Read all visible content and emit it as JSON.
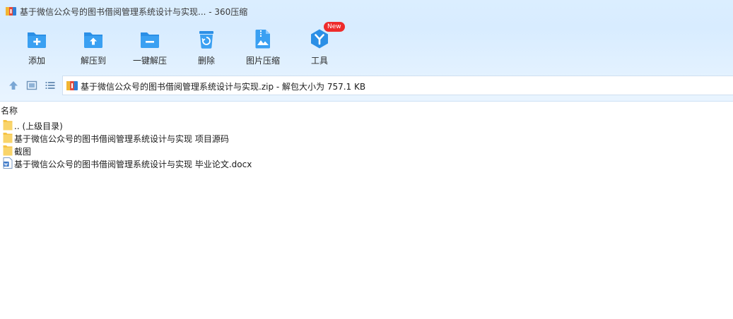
{
  "window": {
    "title": "基于微信公众号的图书借阅管理系统设计与实现... - 360压缩"
  },
  "toolbar": {
    "items": [
      {
        "label": "添加",
        "icon": "add-folder-icon"
      },
      {
        "label": "解压到",
        "icon": "extract-to-icon"
      },
      {
        "label": "一键解压",
        "icon": "one-click-extract-icon"
      },
      {
        "label": "删除",
        "icon": "trash-icon"
      },
      {
        "label": "图片压缩",
        "icon": "image-compress-icon"
      },
      {
        "label": "工具",
        "icon": "tools-icon",
        "badge": "New"
      }
    ]
  },
  "address": {
    "path": "基于微信公众号的图书借阅管理系统设计与实现.zip - 解包大小为 757.1 KB"
  },
  "list": {
    "column_name": "名称",
    "rows": [
      {
        "name": ".. (上级目录)",
        "type": "folder"
      },
      {
        "name": "基于微信公众号的图书借阅管理系统设计与实现 项目源码",
        "type": "folder"
      },
      {
        "name": "截图",
        "type": "folder"
      },
      {
        "name": "基于微信公众号的图书借阅管理系统设计与实现 毕业论文.docx",
        "type": "docx"
      }
    ]
  },
  "colors": {
    "accent": "#2b8fe6",
    "badge": "#ee2b2b",
    "folder": "#f6c343"
  }
}
